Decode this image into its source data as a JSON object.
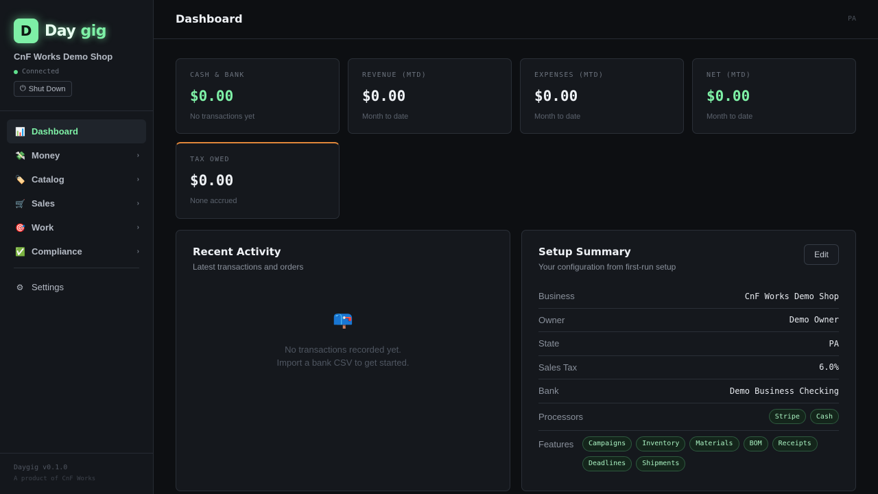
{
  "sidebar": {
    "logo_letter": "D",
    "brand_name_a": "Day",
    "brand_name_b": "gig",
    "shop_name": "CnF Works Demo Shop",
    "connection_status": "Connected",
    "shutdown_label": "Shut Down",
    "shutdown_icon": "⏻",
    "items": [
      {
        "label": "Dashboard",
        "icon": "📊",
        "icon_name": "bar-chart-icon"
      },
      {
        "label": "Money",
        "icon": "💸",
        "icon_name": "money-icon"
      },
      {
        "label": "Catalog",
        "icon": "🏷️",
        "icon_name": "tag-icon"
      },
      {
        "label": "Sales",
        "icon": "🛒",
        "icon_name": "cart-icon"
      },
      {
        "label": "Work",
        "icon": "🎯",
        "icon_name": "target-icon"
      },
      {
        "label": "Compliance",
        "icon": "✅",
        "icon_name": "check-icon"
      }
    ],
    "chevron": "›",
    "settings_label": "Settings",
    "settings_icon": "⚙",
    "version": "Daygig v0.1.0",
    "product_of": "A product of CnF Works"
  },
  "header": {
    "title": "Dashboard",
    "user_initials": "PA"
  },
  "stats": [
    {
      "label": "CASH & BANK",
      "value": "$0.00",
      "sub": "No transactions yet"
    },
    {
      "label": "REVENUE (MTD)",
      "value": "$0.00",
      "sub": "Month to date"
    },
    {
      "label": "EXPENSES (MTD)",
      "value": "$0.00",
      "sub": "Month to date"
    },
    {
      "label": "NET (MTD)",
      "value": "$0.00",
      "sub": "Month to date"
    },
    {
      "label": "TAX OWED",
      "value": "$0.00",
      "sub": "None accrued"
    }
  ],
  "activity": {
    "title": "Recent Activity",
    "subtitle": "Latest transactions and orders",
    "empty_icon": "📪",
    "empty_line1": "No transactions recorded yet.",
    "empty_line2": "Import a bank CSV to get started."
  },
  "setup": {
    "title": "Setup Summary",
    "subtitle": "Your configuration from first-run setup",
    "edit_label": "Edit",
    "rows": [
      {
        "label": "Business",
        "value": "CnF Works Demo Shop"
      },
      {
        "label": "Owner",
        "value": "Demo Owner"
      },
      {
        "label": "State",
        "value": "PA"
      },
      {
        "label": "Sales Tax",
        "value": "6.0%"
      },
      {
        "label": "Bank",
        "value": "Demo Business Checking"
      }
    ],
    "processors_label": "Processors",
    "processors": [
      "Stripe",
      "Cash"
    ],
    "features_label": "Features",
    "features": [
      "Campaigns",
      "Inventory",
      "Materials",
      "BOM",
      "Receipts",
      "Deadlines",
      "Shipments"
    ]
  },
  "colors": {
    "accent_green": "#7ef0a6",
    "tax_accent": "#e0873a",
    "background": "#0d0f12"
  }
}
